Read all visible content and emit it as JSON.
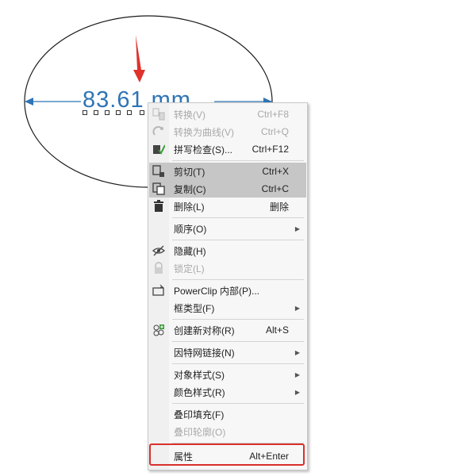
{
  "canvas": {
    "dimension_text": "83.61 mm",
    "ellipse_stroke": "#1a1a1a",
    "dimension_color": "#2f74b5",
    "arrow_color": "#e0312b"
  },
  "menu": {
    "items": [
      {
        "label": "转换(V)",
        "shortcut": "Ctrl+F8",
        "icon": "convert-icon",
        "disabled": true
      },
      {
        "label": "转换为曲线(V)",
        "shortcut": "Ctrl+Q",
        "icon": "convert-curves-icon",
        "disabled": true
      },
      {
        "label": "拼写检查(S)...",
        "shortcut": "Ctrl+F12",
        "icon": "spellcheck-icon",
        "disabled": false
      },
      {
        "label": "剪切(T)",
        "shortcut": "Ctrl+X",
        "icon": "cut-icon",
        "disabled": false,
        "highlight": true
      },
      {
        "label": "复制(C)",
        "shortcut": "Ctrl+C",
        "icon": "copy-icon",
        "disabled": false,
        "highlight": true
      },
      {
        "label": "删除(L)",
        "shortcut": "删除",
        "icon": "trash-icon",
        "disabled": false
      },
      {
        "label": "顺序(O)",
        "icon": "",
        "submenu": true
      },
      {
        "label": "隐藏(H)",
        "icon": "eye-hidden-icon"
      },
      {
        "label": "锁定(L)",
        "icon": "lock-icon",
        "disabled": true
      },
      {
        "label": "PowerClip 内部(P)...",
        "icon": "powerclip-icon"
      },
      {
        "label": "框类型(F)",
        "icon": "",
        "submenu": true
      },
      {
        "label": "创建新对称(R)",
        "shortcut": "Alt+S",
        "icon": "symmetry-icon"
      },
      {
        "label": "因特网链接(N)",
        "icon": "",
        "submenu": true
      },
      {
        "label": "对象样式(S)",
        "icon": "",
        "submenu": true
      },
      {
        "label": "颜色样式(R)",
        "icon": "",
        "submenu": true
      },
      {
        "label": "叠印填充(F)",
        "icon": ""
      },
      {
        "label": "叠印轮廓(O)",
        "icon": "",
        "disabled": true
      },
      {
        "label": "属性",
        "shortcut": "Alt+Enter",
        "icon": ""
      }
    ]
  },
  "colors": {
    "highlight": "#c6c6c6",
    "annotation_red": "#d9302c"
  }
}
